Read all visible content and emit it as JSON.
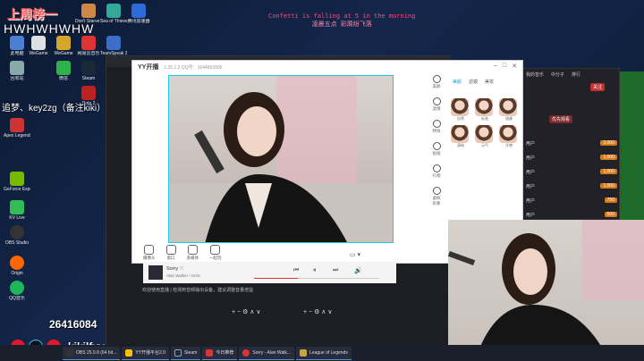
{
  "overlay": {
    "rank": "上周榜一",
    "watermark": "HWHWHWHW",
    "sub_note": "追梦、key2zg（备注kiki）",
    "marquee_line1": "Confetti is falling at 5 in the morning",
    "marquee_line2": "凌晨五点 彩屑纷飞落",
    "count": "26416084",
    "handle": "kikilfyy"
  },
  "desktop_icons": [
    {
      "label": "此电脑",
      "color": "#4a7fd1"
    },
    {
      "label": "WeGame",
      "color": "#e0e0e0"
    },
    {
      "label": "网易云音乐",
      "color": "#d33"
    },
    {
      "label": "Sea of Thieves",
      "color": "#3a9"
    },
    {
      "label": "腾讯加速器",
      "color": "#2b6cd8"
    },
    {
      "label": "回收站",
      "color": "#8aa"
    },
    {
      "label": "WeGame",
      "color": "#d3a72a"
    },
    {
      "label": "Don't Starve Together",
      "color": "#c84"
    },
    {
      "label": "TeamSpeak 3 Client",
      "color": "#3a6ec8"
    },
    {
      "label": "Steam",
      "color": "#1b2838"
    },
    {
      "label": "微信",
      "color": "#2db24a"
    },
    {
      "label": "Dota 2",
      "color": "#b22"
    },
    {
      "label": "Apex Legends",
      "color": "#c33"
    },
    {
      "label": "GeForce Experience",
      "color": "#76b900"
    },
    {
      "label": "KV Live",
      "color": "#3b5"
    },
    {
      "label": "OBS Studio",
      "color": "#333"
    },
    {
      "label": "Origin",
      "color": "#f60"
    },
    {
      "label": "QQ音乐",
      "color": "#1fb55a"
    }
  ],
  "yy_window": {
    "logo": "YY开播",
    "version": "1.25.1.2  QQ号：1644893905",
    "win_minimize": "–",
    "win_maximize": "□",
    "win_close": "✕",
    "side_tools": [
      "美颜",
      "滤镜",
      "特效",
      "贴纸",
      "礼物",
      "虚拟形象"
    ],
    "face_tabs": [
      "美颜",
      "滤镜",
      "美妆"
    ],
    "face_presets": [
      "自然",
      "标准",
      "甜美",
      "清纯",
      "元气",
      "冷艳"
    ],
    "bottom_tools": [
      "摄像头",
      "窗口",
      "多媒体",
      "一起玩"
    ],
    "camera_label": "▭ ▾"
  },
  "music_player": {
    "song": "Sorry  ♡",
    "artist": "Alan Walker / ISÁK",
    "prev": "⏮",
    "play": "⏸",
    "next": "⏭",
    "volume": "🔊",
    "progress": 0.35
  },
  "chat_panel": {
    "tabs": [
      "我的音乐",
      "中分子",
      "排行"
    ],
    "follow_button": "关注",
    "filter_button": "优先观看",
    "rows": [
      {
        "label": "用户",
        "value": "3,000"
      },
      {
        "label": "用户",
        "value": "1,000"
      },
      {
        "label": "用户",
        "value": "1,000"
      },
      {
        "label": "用户",
        "value": "1,000"
      },
      {
        "label": "用户",
        "value": "750"
      },
      {
        "label": "用户",
        "value": "500"
      }
    ]
  },
  "obs_panel": {
    "status_line": "欢迎使用直播 | 检测到音频输出设备，建议调整音量增益",
    "bottom_controls": "+ − ⚙ ∧ ∨"
  },
  "taskbar": {
    "items": [
      {
        "label": "OBS 25.0.8 (64 bit...",
        "color": "#333"
      },
      {
        "label": "YY开播平台2.0",
        "color": "#f5c000"
      },
      {
        "label": "Steam",
        "color": "#1b2838"
      },
      {
        "label": "今日推荐",
        "color": "#d33"
      },
      {
        "label": "Sorry - Alan Walk...",
        "color": "#d33"
      },
      {
        "label": "League of Legends",
        "color": "#c9a63a"
      }
    ]
  }
}
